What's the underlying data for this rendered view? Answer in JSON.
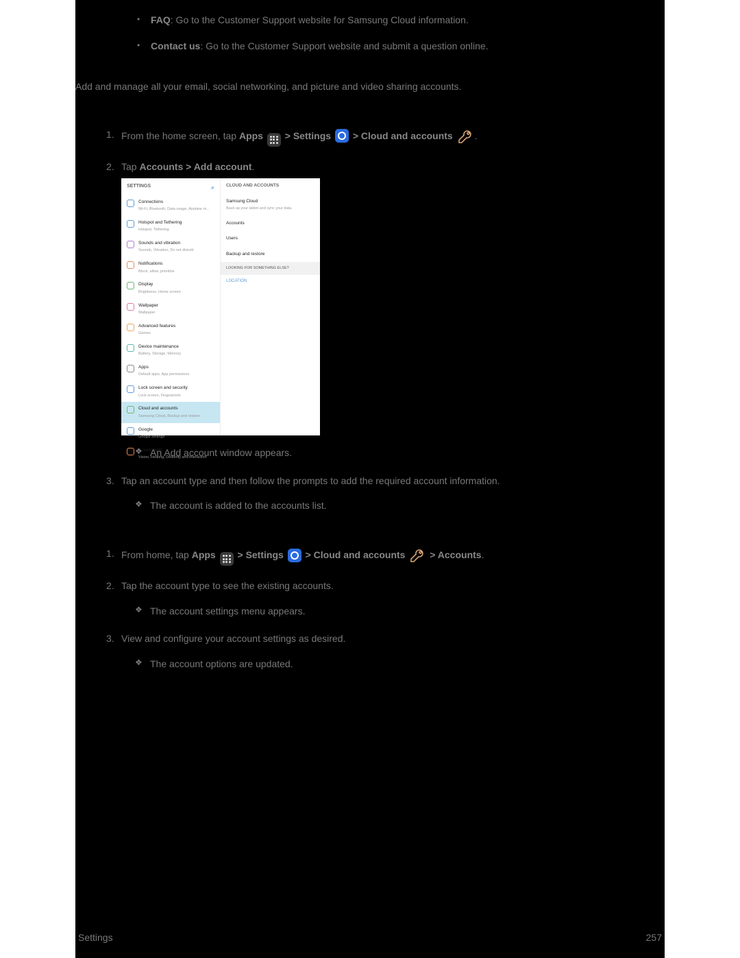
{
  "bullets": [
    {
      "bold": "FAQ",
      "text": ": Go to the Customer Support website for Samsung Cloud information."
    },
    {
      "bold": "Contact us",
      "text": ": Go to the Customer Support website and submit a question online."
    }
  ],
  "intro": "Add and manage all your email, social networking, and picture and video sharing accounts.",
  "set_up": {
    "step1_pre": "From the home screen, tap ",
    "apps": "Apps",
    "gt1": " > ",
    "settings": "Settings",
    "gt2": " > ",
    "cloud": "Cloud and accounts",
    "dot": ".",
    "step2_pre": "Tap ",
    "step2_bold": "Accounts > Add account",
    "step2_post": ".",
    "sub1": "An Add account window appears.",
    "step3": "Tap an account type and then follow the prompts to add the required account information.",
    "sub3": "The account is added to the accounts list."
  },
  "manage": {
    "step1_pre": "From home, tap ",
    "apps": "Apps",
    "gt1": " > ",
    "settings": "Settings",
    "gt2": " > ",
    "cloud": "Cloud and accounts",
    "gt3": " > ",
    "accounts": "Accounts",
    "dot": ".",
    "step2": "Tap the account type to see the existing accounts.",
    "sub2": "The account settings menu appears.",
    "step3": "View and configure your account settings as desired.",
    "sub3": "The account options are updated."
  },
  "shot": {
    "left_header": "SETTINGS",
    "right_header": "CLOUD AND ACCOUNTS",
    "left_items": [
      {
        "title": "Connections",
        "sub": "Wi-Fi, Bluetooth, Data usage, Airplane m...",
        "color": "#5b9bd5"
      },
      {
        "title": "Hotspot and Tethering",
        "sub": "Hotspot, Tethering",
        "color": "#5b9bd5"
      },
      {
        "title": "Sounds and vibration",
        "sub": "Sounds, Vibration, Do not disturb",
        "color": "#b07bd0"
      },
      {
        "title": "Notifications",
        "sub": "Block, allow, prioritize",
        "color": "#e68a5c"
      },
      {
        "title": "Display",
        "sub": "Brightness, Home screen",
        "color": "#6db56d"
      },
      {
        "title": "Wallpaper",
        "sub": "Wallpaper",
        "color": "#d97ba8"
      },
      {
        "title": "Advanced features",
        "sub": "Games",
        "color": "#e6a85c"
      },
      {
        "title": "Device maintenance",
        "sub": "Battery, Storage, Memory",
        "color": "#5bb5a8"
      },
      {
        "title": "Apps",
        "sub": "Default apps, App permissions",
        "color": "#888"
      },
      {
        "title": "Lock screen and security",
        "sub": "Lock screen, Fingerprints",
        "color": "#5b9bd5"
      },
      {
        "title": "Cloud and accounts",
        "sub": "Samsung Cloud, Backup and restore",
        "color": "#6db56d",
        "selected": true
      },
      {
        "title": "Google",
        "sub": "Google settings",
        "color": "#5b9bd5"
      },
      {
        "title": "Accessibility",
        "sub": "Vision, Hearing, Dexterity and interaction",
        "color": "#e68a5c"
      }
    ],
    "right_items": [
      {
        "title": "Samsung Cloud",
        "sub": "Back up your tablet and sync your data."
      },
      {
        "title": "Accounts",
        "sub": ""
      },
      {
        "title": "Users",
        "sub": ""
      },
      {
        "title": "Backup and restore",
        "sub": ""
      }
    ],
    "looking": "LOOKING FOR SOMETHING ELSE?",
    "location": "LOCATION"
  },
  "footer": {
    "left": "Settings",
    "right": "257"
  }
}
